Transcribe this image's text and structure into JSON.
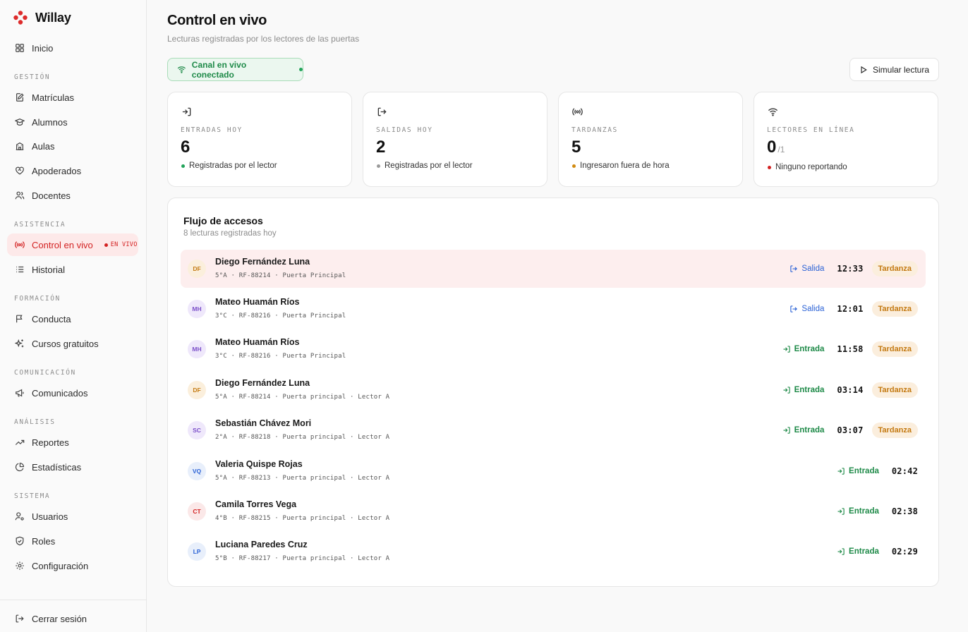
{
  "app": {
    "name": "Willay",
    "brand_color": "#dd2b2b"
  },
  "sidebar": {
    "home": {
      "label": "Inicio",
      "icon": "grid-icon"
    },
    "sections": [
      {
        "title": "GESTIÓN",
        "items": [
          {
            "label": "Matrículas",
            "icon": "edit-icon"
          },
          {
            "label": "Alumnos",
            "icon": "graduation-cap-icon"
          },
          {
            "label": "Aulas",
            "icon": "building-icon"
          },
          {
            "label": "Apoderados",
            "icon": "heart-handshake-icon"
          },
          {
            "label": "Docentes",
            "icon": "users-icon"
          }
        ]
      },
      {
        "title": "ASISTENCIA",
        "items": [
          {
            "label": "Control en vivo",
            "icon": "radio-icon",
            "active": true,
            "badge": "EN VIVO"
          },
          {
            "label": "Historial",
            "icon": "list-icon"
          }
        ]
      },
      {
        "title": "FORMACIÓN",
        "items": [
          {
            "label": "Conducta",
            "icon": "flag-icon"
          },
          {
            "label": "Cursos gratuitos",
            "icon": "sparkles-icon"
          }
        ]
      },
      {
        "title": "COMUNICACIÓN",
        "items": [
          {
            "label": "Comunicados",
            "icon": "megaphone-icon"
          }
        ]
      },
      {
        "title": "ANÁLISIS",
        "items": [
          {
            "label": "Reportes",
            "icon": "trending-up-icon"
          },
          {
            "label": "Estadísticas",
            "icon": "pie-chart-icon"
          }
        ]
      },
      {
        "title": "SISTEMA",
        "items": [
          {
            "label": "Usuarios",
            "icon": "user-cog-icon"
          },
          {
            "label": "Roles",
            "icon": "shield-icon"
          },
          {
            "label": "Configuración",
            "icon": "gear-icon"
          }
        ]
      }
    ],
    "logout": {
      "label": "Cerrar sesión",
      "icon": "logout-icon"
    }
  },
  "header": {
    "title": "Control en vivo",
    "subtitle": "Lecturas registradas por los lectores de las puertas",
    "connection_status": "Canal en vivo conectado",
    "simulate_button": "Simular lectura"
  },
  "stats": [
    {
      "label": "ENTRADAS HOY",
      "value": "6",
      "note": "Registradas por el lector",
      "dot_color": "#22a35a",
      "icon": "login-icon"
    },
    {
      "label": "SALIDAS HOY",
      "value": "2",
      "note": "Registradas por el lector",
      "dot_color": "#9a9a9a",
      "icon": "logout-icon"
    },
    {
      "label": "TARDANZAS",
      "value": "5",
      "note": "Ingresaron fuera de hora",
      "dot_color": "#d18a10",
      "icon": "radio-icon"
    },
    {
      "label": "LECTORES EN LÍNEA",
      "value": "0",
      "total": "/1",
      "note": "Ninguno reportando",
      "dot_color": "#d32222",
      "icon": "wifi-icon"
    }
  ],
  "flow": {
    "title": "Flujo de accesos",
    "subtitle": "8 lecturas registradas hoy",
    "rows": [
      {
        "initials": "DF",
        "name": "Diego Fernández Luna",
        "meta": "5°A · RF-88214 · Puerta Principal",
        "direction": "Salida",
        "time": "12:33",
        "late": "Tardanza",
        "highlight": true
      },
      {
        "initials": "MH",
        "name": "Mateo Huamán Ríos",
        "meta": "3°C · RF-88216 · Puerta Principal",
        "direction": "Salida",
        "time": "12:01",
        "late": "Tardanza"
      },
      {
        "initials": "MH",
        "name": "Mateo Huamán Ríos",
        "meta": "3°C · RF-88216 · Puerta Principal",
        "direction": "Entrada",
        "time": "11:58",
        "late": "Tardanza"
      },
      {
        "initials": "DF",
        "name": "Diego Fernández Luna",
        "meta": "5°A · RF-88214 · Puerta principal · Lector A",
        "direction": "Entrada",
        "time": "03:14",
        "late": "Tardanza"
      },
      {
        "initials": "SC",
        "name": "Sebastián Chávez Mori",
        "meta": "2°A · RF-88218 · Puerta principal · Lector A",
        "direction": "Entrada",
        "time": "03:07",
        "late": "Tardanza"
      },
      {
        "initials": "VQ",
        "name": "Valeria Quispe Rojas",
        "meta": "5°A · RF-88213 · Puerta principal · Lector A",
        "direction": "Entrada",
        "time": "02:42"
      },
      {
        "initials": "CT",
        "name": "Camila Torres Vega",
        "meta": "4°B · RF-88215 · Puerta principal · Lector A",
        "direction": "Entrada",
        "time": "02:38"
      },
      {
        "initials": "LP",
        "name": "Luciana Paredes Cruz",
        "meta": "5°B · RF-88217 · Puerta principal · Lector A",
        "direction": "Entrada",
        "time": "02:29"
      }
    ]
  }
}
